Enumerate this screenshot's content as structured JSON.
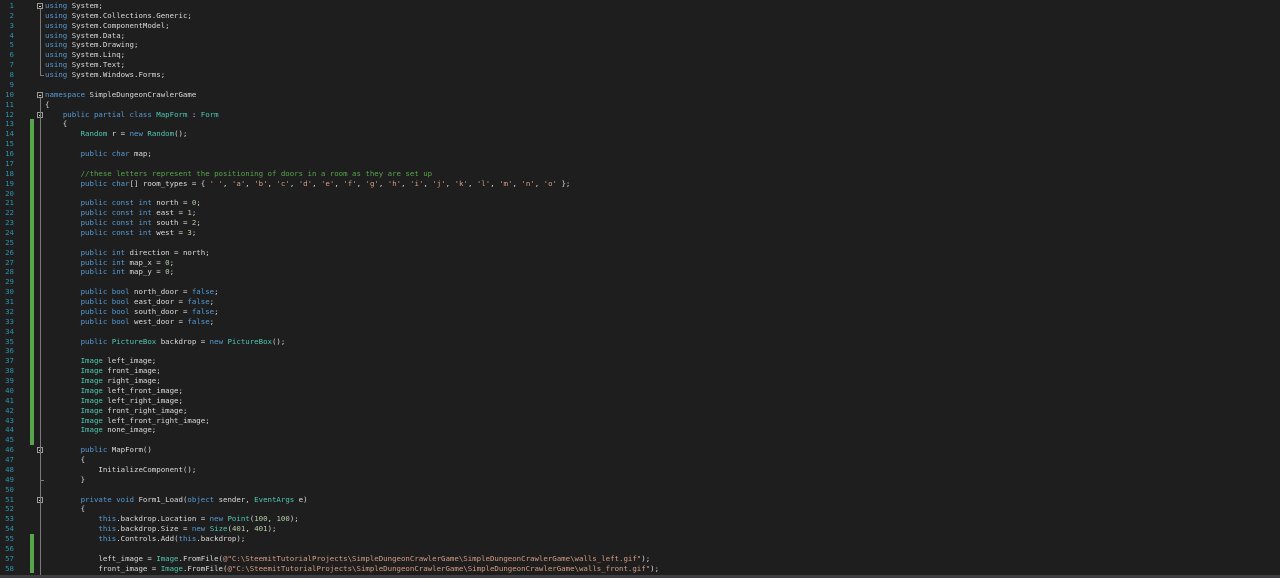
{
  "editor": {
    "colors": {
      "background": "#1e1e1e",
      "keyword": "#569cd6",
      "type": "#4ec9b0",
      "comment": "#57a64a",
      "string": "#d69d85",
      "number": "#b5cea8",
      "plain": "#dcdcdc",
      "line_number": "#2b91af",
      "change_bar": "#57a64a"
    },
    "lines": [
      {
        "n": "1",
        "segs": [
          [
            "kw",
            "using"
          ],
          [
            "pl",
            " System;"
          ]
        ]
      },
      {
        "n": "2",
        "segs": [
          [
            "kw",
            "using"
          ],
          [
            "pl",
            " System.Collections.Generic;"
          ]
        ]
      },
      {
        "n": "3",
        "segs": [
          [
            "kw",
            "using"
          ],
          [
            "pl",
            " System.ComponentModel;"
          ]
        ]
      },
      {
        "n": "4",
        "segs": [
          [
            "kw",
            "using"
          ],
          [
            "pl",
            " System.Data;"
          ]
        ]
      },
      {
        "n": "5",
        "segs": [
          [
            "kw",
            "using"
          ],
          [
            "pl",
            " System.Drawing;"
          ]
        ]
      },
      {
        "n": "6",
        "segs": [
          [
            "kw",
            "using"
          ],
          [
            "pl",
            " System.Linq;"
          ]
        ]
      },
      {
        "n": "7",
        "segs": [
          [
            "kw",
            "using"
          ],
          [
            "pl",
            " System.Text;"
          ]
        ]
      },
      {
        "n": "8",
        "segs": [
          [
            "kw",
            "using"
          ],
          [
            "pl",
            " System.Windows.Forms;"
          ]
        ]
      },
      {
        "n": "9",
        "segs": []
      },
      {
        "n": "10",
        "segs": [
          [
            "kw",
            "namespace"
          ],
          [
            "pl",
            " SimpleDungeonCrawlerGame"
          ]
        ]
      },
      {
        "n": "11",
        "segs": [
          [
            "pl",
            "{"
          ]
        ]
      },
      {
        "n": "12",
        "segs": [
          [
            "pl",
            "    "
          ],
          [
            "kw",
            "public partial class"
          ],
          [
            "pl",
            " "
          ],
          [
            "ty",
            "MapForm"
          ],
          [
            "pl",
            " : "
          ],
          [
            "ty",
            "Form"
          ]
        ]
      },
      {
        "n": "13",
        "segs": [
          [
            "pl",
            "    {"
          ]
        ]
      },
      {
        "n": "14",
        "segs": [
          [
            "pl",
            "        "
          ],
          [
            "ty",
            "Random"
          ],
          [
            "pl",
            " r = "
          ],
          [
            "kw",
            "new"
          ],
          [
            "pl",
            " "
          ],
          [
            "ty",
            "Random"
          ],
          [
            "pl",
            "();"
          ]
        ]
      },
      {
        "n": "15",
        "segs": []
      },
      {
        "n": "16",
        "segs": [
          [
            "pl",
            "        "
          ],
          [
            "kw",
            "public char"
          ],
          [
            "pl",
            " map;"
          ]
        ]
      },
      {
        "n": "17",
        "segs": []
      },
      {
        "n": "18",
        "segs": [
          [
            "pl",
            "        "
          ],
          [
            "cm",
            "//these letters represent the positioning of doors in a room as they are set up"
          ]
        ]
      },
      {
        "n": "19",
        "segs": [
          [
            "pl",
            "        "
          ],
          [
            "kw",
            "public char"
          ],
          [
            "pl",
            "[] room_types = { "
          ],
          [
            "st",
            "' '"
          ],
          [
            "pl",
            ", "
          ],
          [
            "st",
            "'a'"
          ],
          [
            "pl",
            ", "
          ],
          [
            "st",
            "'b'"
          ],
          [
            "pl",
            ", "
          ],
          [
            "st",
            "'c'"
          ],
          [
            "pl",
            ", "
          ],
          [
            "st",
            "'d'"
          ],
          [
            "pl",
            ", "
          ],
          [
            "st",
            "'e'"
          ],
          [
            "pl",
            ", "
          ],
          [
            "st",
            "'f'"
          ],
          [
            "pl",
            ", "
          ],
          [
            "st",
            "'g'"
          ],
          [
            "pl",
            ", "
          ],
          [
            "st",
            "'h'"
          ],
          [
            "pl",
            ", "
          ],
          [
            "st",
            "'i'"
          ],
          [
            "pl",
            ", "
          ],
          [
            "st",
            "'j'"
          ],
          [
            "pl",
            ", "
          ],
          [
            "st",
            "'k'"
          ],
          [
            "pl",
            ", "
          ],
          [
            "st",
            "'l'"
          ],
          [
            "pl",
            ", "
          ],
          [
            "st",
            "'m'"
          ],
          [
            "pl",
            ", "
          ],
          [
            "st",
            "'n'"
          ],
          [
            "pl",
            ", "
          ],
          [
            "st",
            "'o'"
          ],
          [
            "pl",
            " };"
          ]
        ]
      },
      {
        "n": "20",
        "segs": []
      },
      {
        "n": "21",
        "segs": [
          [
            "pl",
            "        "
          ],
          [
            "kw",
            "public const int"
          ],
          [
            "pl",
            " north = "
          ],
          [
            "nu",
            "0"
          ],
          [
            "pl",
            ";"
          ]
        ]
      },
      {
        "n": "22",
        "segs": [
          [
            "pl",
            "        "
          ],
          [
            "kw",
            "public const int"
          ],
          [
            "pl",
            " east = "
          ],
          [
            "nu",
            "1"
          ],
          [
            "pl",
            ";"
          ]
        ]
      },
      {
        "n": "23",
        "segs": [
          [
            "pl",
            "        "
          ],
          [
            "kw",
            "public const int"
          ],
          [
            "pl",
            " south = "
          ],
          [
            "nu",
            "2"
          ],
          [
            "pl",
            ";"
          ]
        ]
      },
      {
        "n": "24",
        "segs": [
          [
            "pl",
            "        "
          ],
          [
            "kw",
            "public const int"
          ],
          [
            "pl",
            " west = "
          ],
          [
            "nu",
            "3"
          ],
          [
            "pl",
            ";"
          ]
        ]
      },
      {
        "n": "25",
        "segs": []
      },
      {
        "n": "26",
        "segs": [
          [
            "pl",
            "        "
          ],
          [
            "kw",
            "public int"
          ],
          [
            "pl",
            " direction = north;"
          ]
        ]
      },
      {
        "n": "27",
        "segs": [
          [
            "pl",
            "        "
          ],
          [
            "kw",
            "public int"
          ],
          [
            "pl",
            " map_x = "
          ],
          [
            "nu",
            "0"
          ],
          [
            "pl",
            ";"
          ]
        ]
      },
      {
        "n": "28",
        "segs": [
          [
            "pl",
            "        "
          ],
          [
            "kw",
            "public int"
          ],
          [
            "pl",
            " map_y = "
          ],
          [
            "nu",
            "0"
          ],
          [
            "pl",
            ";"
          ]
        ]
      },
      {
        "n": "29",
        "segs": []
      },
      {
        "n": "30",
        "segs": [
          [
            "pl",
            "        "
          ],
          [
            "kw",
            "public bool"
          ],
          [
            "pl",
            " north_door = "
          ],
          [
            "kw",
            "false"
          ],
          [
            "pl",
            ";"
          ]
        ]
      },
      {
        "n": "31",
        "segs": [
          [
            "pl",
            "        "
          ],
          [
            "kw",
            "public bool"
          ],
          [
            "pl",
            " east_door = "
          ],
          [
            "kw",
            "false"
          ],
          [
            "pl",
            ";"
          ]
        ]
      },
      {
        "n": "32",
        "segs": [
          [
            "pl",
            "        "
          ],
          [
            "kw",
            "public bool"
          ],
          [
            "pl",
            " south_door = "
          ],
          [
            "kw",
            "false"
          ],
          [
            "pl",
            ";"
          ]
        ]
      },
      {
        "n": "33",
        "segs": [
          [
            "pl",
            "        "
          ],
          [
            "kw",
            "public bool"
          ],
          [
            "pl",
            " west_door = "
          ],
          [
            "kw",
            "false"
          ],
          [
            "pl",
            ";"
          ]
        ]
      },
      {
        "n": "34",
        "segs": []
      },
      {
        "n": "35",
        "segs": [
          [
            "pl",
            "        "
          ],
          [
            "kw",
            "public"
          ],
          [
            "pl",
            " "
          ],
          [
            "ty",
            "PictureBox"
          ],
          [
            "pl",
            " backdrop = "
          ],
          [
            "kw",
            "new"
          ],
          [
            "pl",
            " "
          ],
          [
            "ty",
            "PictureBox"
          ],
          [
            "pl",
            "();"
          ]
        ]
      },
      {
        "n": "36",
        "segs": []
      },
      {
        "n": "37",
        "segs": [
          [
            "pl",
            "        "
          ],
          [
            "ty",
            "Image"
          ],
          [
            "pl",
            " left_image;"
          ]
        ]
      },
      {
        "n": "38",
        "segs": [
          [
            "pl",
            "        "
          ],
          [
            "ty",
            "Image"
          ],
          [
            "pl",
            " front_image;"
          ]
        ]
      },
      {
        "n": "39",
        "segs": [
          [
            "pl",
            "        "
          ],
          [
            "ty",
            "Image"
          ],
          [
            "pl",
            " right_image;"
          ]
        ]
      },
      {
        "n": "40",
        "segs": [
          [
            "pl",
            "        "
          ],
          [
            "ty",
            "Image"
          ],
          [
            "pl",
            " left_front_image;"
          ]
        ]
      },
      {
        "n": "41",
        "segs": [
          [
            "pl",
            "        "
          ],
          [
            "ty",
            "Image"
          ],
          [
            "pl",
            " left_right_image;"
          ]
        ]
      },
      {
        "n": "42",
        "segs": [
          [
            "pl",
            "        "
          ],
          [
            "ty",
            "Image"
          ],
          [
            "pl",
            " front_right_image;"
          ]
        ]
      },
      {
        "n": "43",
        "segs": [
          [
            "pl",
            "        "
          ],
          [
            "ty",
            "Image"
          ],
          [
            "pl",
            " left_front_right_image;"
          ]
        ]
      },
      {
        "n": "44",
        "segs": [
          [
            "pl",
            "        "
          ],
          [
            "ty",
            "Image"
          ],
          [
            "pl",
            " none_image;"
          ]
        ]
      },
      {
        "n": "45",
        "segs": []
      },
      {
        "n": "46",
        "segs": [
          [
            "pl",
            "        "
          ],
          [
            "kw",
            "public"
          ],
          [
            "pl",
            " MapForm()"
          ]
        ]
      },
      {
        "n": "47",
        "segs": [
          [
            "pl",
            "        {"
          ]
        ]
      },
      {
        "n": "48",
        "segs": [
          [
            "pl",
            "            InitializeComponent();"
          ]
        ]
      },
      {
        "n": "49",
        "segs": [
          [
            "pl",
            "        }"
          ]
        ]
      },
      {
        "n": "50",
        "segs": []
      },
      {
        "n": "51",
        "segs": [
          [
            "pl",
            "        "
          ],
          [
            "kw",
            "private void"
          ],
          [
            "pl",
            " Form1_Load("
          ],
          [
            "kw",
            "object"
          ],
          [
            "pl",
            " sender, "
          ],
          [
            "ty",
            "EventArgs"
          ],
          [
            "pl",
            " e)"
          ]
        ]
      },
      {
        "n": "52",
        "segs": [
          [
            "pl",
            "        {"
          ]
        ]
      },
      {
        "n": "53",
        "segs": [
          [
            "pl",
            "            "
          ],
          [
            "kw",
            "this"
          ],
          [
            "pl",
            ".backdrop.Location = "
          ],
          [
            "kw",
            "new"
          ],
          [
            "pl",
            " "
          ],
          [
            "ty",
            "Point"
          ],
          [
            "pl",
            "("
          ],
          [
            "nu",
            "100"
          ],
          [
            "pl",
            ", "
          ],
          [
            "nu",
            "100"
          ],
          [
            "pl",
            ");"
          ]
        ]
      },
      {
        "n": "54",
        "segs": [
          [
            "pl",
            "            "
          ],
          [
            "kw",
            "this"
          ],
          [
            "pl",
            ".backdrop.Size = "
          ],
          [
            "kw",
            "new"
          ],
          [
            "pl",
            " "
          ],
          [
            "ty",
            "Size"
          ],
          [
            "pl",
            "("
          ],
          [
            "nu",
            "401"
          ],
          [
            "pl",
            ", "
          ],
          [
            "nu",
            "401"
          ],
          [
            "pl",
            ");"
          ]
        ]
      },
      {
        "n": "55",
        "segs": [
          [
            "pl",
            "            "
          ],
          [
            "kw",
            "this"
          ],
          [
            "pl",
            ".Controls.Add("
          ],
          [
            "kw",
            "this"
          ],
          [
            "pl",
            ".backdrop);"
          ]
        ]
      },
      {
        "n": "56",
        "segs": []
      },
      {
        "n": "57",
        "segs": [
          [
            "pl",
            "            left_image = "
          ],
          [
            "ty",
            "Image"
          ],
          [
            "pl",
            ".FromFile("
          ],
          [
            "st",
            "@\"C:\\SteemitTutorialProjects\\SimpleDungeonCrawlerGame\\SimpleDungeonCrawlerGame\\walls_left.gif\""
          ],
          [
            "pl",
            ");"
          ]
        ]
      },
      {
        "n": "58",
        "segs": [
          [
            "pl",
            "            front_image = "
          ],
          [
            "ty",
            "Image"
          ],
          [
            "pl",
            ".FromFile("
          ],
          [
            "st",
            "@\"C:\\SteemitTutorialProjects\\SimpleDungeonCrawlerGame\\SimpleDungeonCrawlerGame\\walls_front.gif\""
          ],
          [
            "pl",
            ");"
          ]
        ]
      }
    ]
  }
}
